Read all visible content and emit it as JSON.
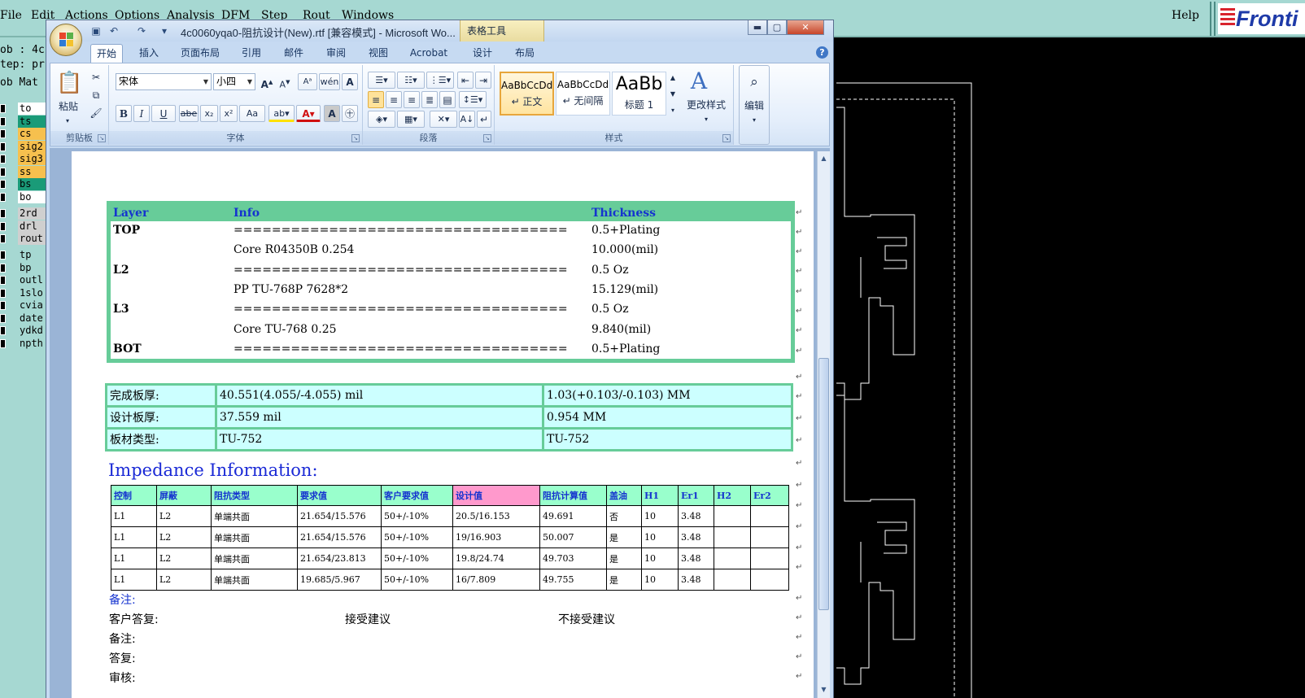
{
  "bg_app": {
    "menus": [
      "File",
      "Edit",
      "Actions",
      "Options",
      "Analysis",
      "DFM",
      "Step",
      "Rout",
      "Windows"
    ],
    "help": "Help",
    "logo_text": "Fronti",
    "info_lines": [
      "ob : 4c",
      "tep: pr",
      "ob Mat"
    ],
    "layers": [
      {
        "name": "to",
        "color": "#ffffff"
      },
      {
        "name": "ts",
        "color": "#1a9b78"
      },
      {
        "name": "cs",
        "color": "#f6c04e"
      },
      {
        "name": "sig2",
        "color": "#f6c04e"
      },
      {
        "name": "sig3",
        "color": "#f6c04e"
      },
      {
        "name": "ss",
        "color": "#f6c04e"
      },
      {
        "name": "bs",
        "color": "#1a9b78"
      },
      {
        "name": "bo",
        "color": "#ffffff"
      },
      {
        "name": "2rd",
        "color": "#cfcfcf"
      },
      {
        "name": "drl",
        "color": "#cfcfcf"
      },
      {
        "name": "rout",
        "color": "#cfcfcf"
      },
      {
        "name": "tp",
        "color": "#a6d8d2"
      },
      {
        "name": "bp",
        "color": "#a6d8d2"
      },
      {
        "name": "outl",
        "color": "#a6d8d2"
      },
      {
        "name": "1slo",
        "color": "#a6d8d2"
      },
      {
        "name": "cvia",
        "color": "#a6d8d2"
      },
      {
        "name": "date",
        "color": "#a6d8d2"
      },
      {
        "name": "ydkd",
        "color": "#a6d8d2"
      },
      {
        "name": "npth",
        "color": "#a6d8d2"
      }
    ]
  },
  "word": {
    "title": "4c0060yqa0-阻抗设计(New).rtf [兼容模式] - Microsoft Wo...",
    "context_tab_title": "表格工具",
    "tabs": [
      "开始",
      "插入",
      "页面布局",
      "引用",
      "邮件",
      "审阅",
      "视图",
      "Acrobat",
      "设计",
      "布局"
    ],
    "ribbon": {
      "clipboard": {
        "label": "剪贴板",
        "paste": "粘贴"
      },
      "font": {
        "label": "字体",
        "font_name": "宋体",
        "font_size": "小四",
        "bold": "B",
        "italic": "I",
        "underline": "U",
        "strike": "abe",
        "subscript": "x₂",
        "superscript": "x²",
        "change_case": "Aa"
      },
      "paragraph": {
        "label": "段落"
      },
      "styles": {
        "label": "样式",
        "items": [
          {
            "sample": "AaBbCcDd",
            "name": "↵ 正文"
          },
          {
            "sample": "AaBbCcDd",
            "name": "↵ 无间隔"
          },
          {
            "sample": "AaBb",
            "name": "标题 1"
          }
        ],
        "change_styles": "更改样式"
      },
      "editing": {
        "label": "编辑"
      }
    }
  },
  "doc": {
    "stackup": {
      "headers": [
        "Layer",
        "Info",
        "Thickness"
      ],
      "rows": [
        {
          "layer": "TOP",
          "info": "===================================",
          "thickness": "0.5+Plating"
        },
        {
          "layer": "",
          "info": "Core     R04350B    0.254",
          "thickness": "10.000(mil)"
        },
        {
          "layer": "L2",
          "info": "===================================",
          "thickness": "0.5 Oz"
        },
        {
          "layer": "",
          "info": "PP     TU-768P    7628*2",
          "thickness": "15.129(mil)"
        },
        {
          "layer": "L3",
          "info": "===================================",
          "thickness": "0.5 Oz"
        },
        {
          "layer": "",
          "info": "Core     TU-768    0.25",
          "thickness": "9.840(mil)"
        },
        {
          "layer": "BOT",
          "info": "===================================",
          "thickness": "0.5+Plating"
        }
      ]
    },
    "thickness_table": [
      [
        "完成板厚:",
        "40.551(4.055/-4.055) mil",
        "1.03(+0.103/-0.103) MM"
      ],
      [
        "设计板厚:",
        "37.559 mil",
        "0.954 MM"
      ],
      [
        "板材类型:",
        "TU-752",
        "TU-752"
      ]
    ],
    "impedance_title": "Impedance Information:",
    "impedance_headers": [
      "控制",
      "屏蔽",
      "阻抗类型",
      "要求值",
      "客户要求值",
      "设计值",
      "阻抗计算值",
      "盖油",
      "H1",
      "Er1",
      "H2",
      "Er2"
    ],
    "impedance_rows": [
      [
        "L1",
        "L2",
        "单端共面",
        "21.654/15.576",
        "50+/-10%",
        "20.5/16.153",
        "49.691",
        "否",
        "10",
        "3.48",
        "",
        ""
      ],
      [
        "L1",
        "L2",
        "单端共面",
        "21.654/15.576",
        "50+/-10%",
        "19/16.903",
        "50.007",
        "是",
        "10",
        "3.48",
        "",
        ""
      ],
      [
        "L1",
        "L2",
        "单端共面",
        "21.654/23.813",
        "50+/-10%",
        "19.8/24.74",
        "49.703",
        "是",
        "10",
        "3.48",
        "",
        ""
      ],
      [
        "L1",
        "L2",
        "单端共面",
        "19.685/5.967",
        "50+/-10%",
        "16/7.809",
        "49.755",
        "是",
        "10",
        "3.48",
        "",
        ""
      ]
    ],
    "notes": {
      "note1": "备注:",
      "customer_reply": "客户答复:",
      "accept": "接受建议",
      "reject": "不接受建议",
      "note2": "备注:",
      "reply": "答复:",
      "review": "审核:"
    }
  }
}
